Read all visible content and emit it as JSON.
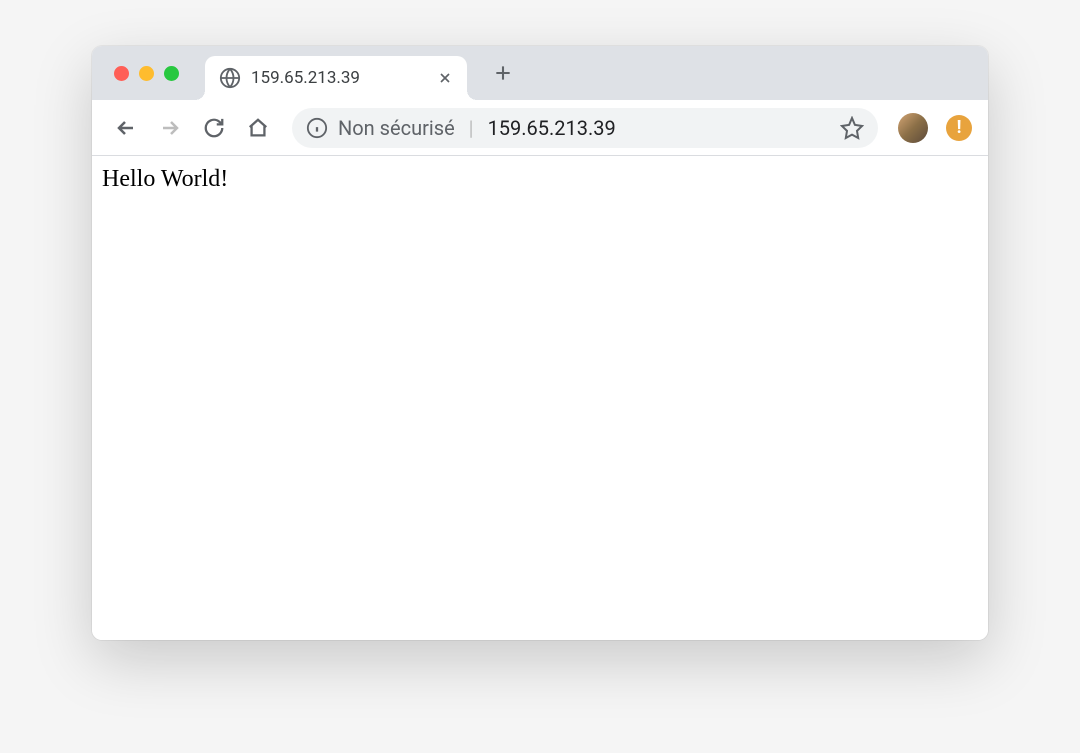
{
  "tab": {
    "title": "159.65.213.39"
  },
  "toolbar": {
    "security_label": "Non sécurisé",
    "url": "159.65.213.39"
  },
  "page": {
    "body_text": "Hello World!"
  },
  "warning_badge": "!"
}
